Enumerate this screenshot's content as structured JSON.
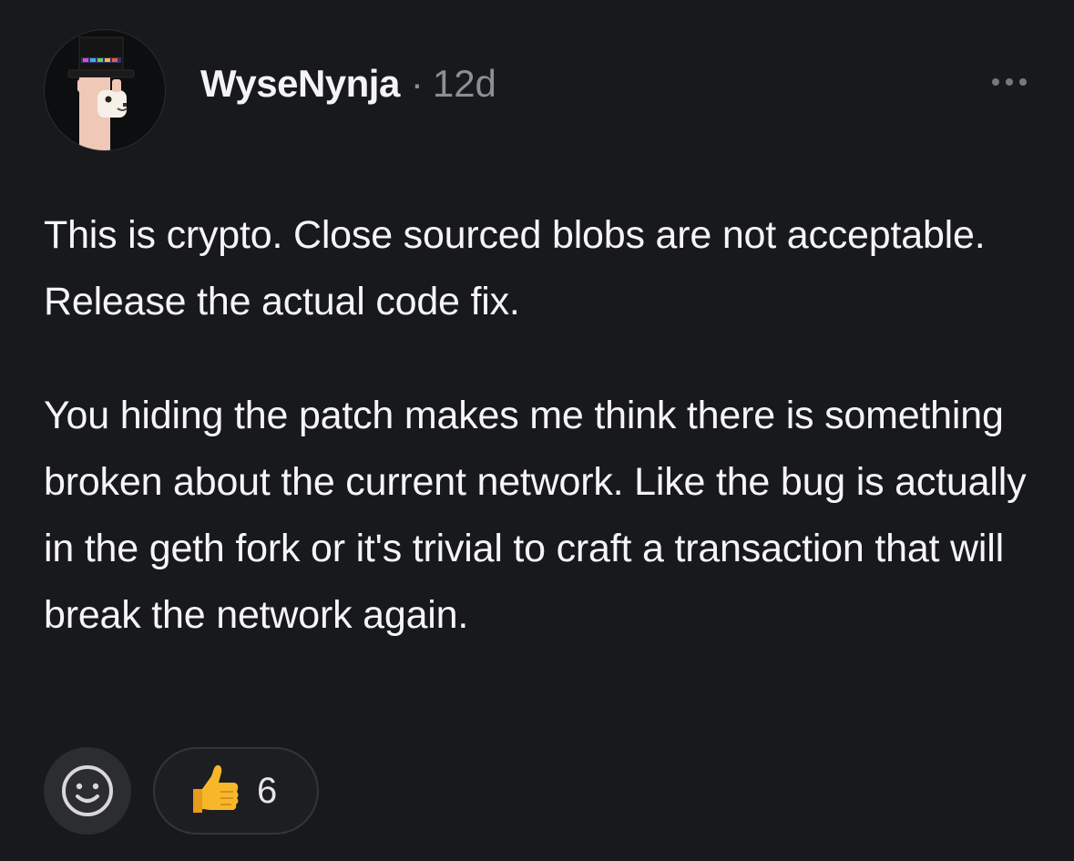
{
  "comment": {
    "author": "WyseNynja",
    "separator": "·",
    "age": "12d",
    "paragraphs": [
      "This is crypto. Close sourced blobs are not acceptable. Release the actual code fix.",
      "You hiding the patch makes me think there is something broken about the current network. Like the bug is actually in the geth fork or it's trivial to craft a transaction that will break the network again."
    ]
  },
  "icons": {
    "more": "more-horizontal-icon",
    "add_reaction": "smiley-face-icon",
    "thumbs_up": "thumbs-up-icon"
  },
  "reactions": [
    {
      "emoji": "thumbs-up",
      "count": "6"
    }
  ],
  "colors": {
    "background": "#18191d",
    "text": "#f5f5f7",
    "muted": "#8e8f94",
    "button": "#2c2d31",
    "thumbs": "#f7b72a"
  }
}
